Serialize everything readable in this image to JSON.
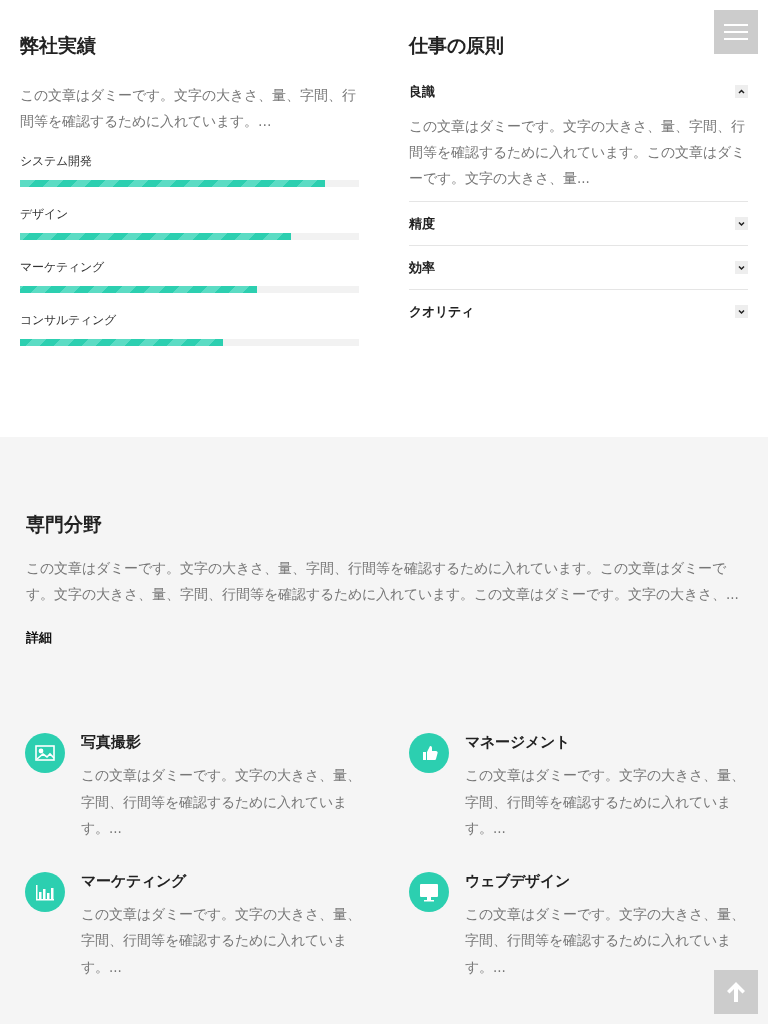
{
  "achievements": {
    "title": "弊社実績",
    "text": "この文章はダミーです。文字の大きさ、量、字間、行間等を確認するために入れています。…",
    "skills": [
      {
        "label": "システム開発",
        "level": 0.9
      },
      {
        "label": "デザイン",
        "level": 0.8
      },
      {
        "label": "マーケティング",
        "level": 0.7
      },
      {
        "label": "コンサルティング",
        "level": 0.6
      }
    ]
  },
  "principles": {
    "title": "仕事の原則",
    "items": [
      {
        "label": "良識",
        "expanded": true,
        "text": "この文章はダミーです。文字の大きさ、量、字間、行間等を確認するために入れています。この文章はダミーです。文字の大きさ、量..."
      },
      {
        "label": "精度",
        "expanded": false
      },
      {
        "label": "効率",
        "expanded": false
      },
      {
        "label": "クオリティ",
        "expanded": false
      }
    ]
  },
  "specialty": {
    "title": "専門分野",
    "text": "この文章はダミーです。文字の大きさ、量、字間、行間等を確認するために入れています。この文章はダミーです。文字の大きさ、量、字間、行間等を確認するために入れています。この文章はダミーです。文字の大きさ、...",
    "link": "詳細"
  },
  "services": [
    {
      "kind": "photo",
      "title": "写真撮影",
      "text": "この文章はダミーです。文字の大きさ、量、字間、行間等を確認するために入れています。..."
    },
    {
      "kind": "like",
      "title": "マネージメント",
      "text": "この文章はダミーです。文字の大きさ、量、字間、行間等を確認するために入れています。..."
    },
    {
      "kind": "chart",
      "title": "マーケティング",
      "text": "この文章はダミーです。文字の大きさ、量、字間、行間等を確認するために入れています。..."
    },
    {
      "kind": "monitor",
      "title": "ウェブデザイン",
      "text": "この文章はダミーです。文字の大きさ、量、字間、行間等を確認するために入れています。..."
    }
  ]
}
